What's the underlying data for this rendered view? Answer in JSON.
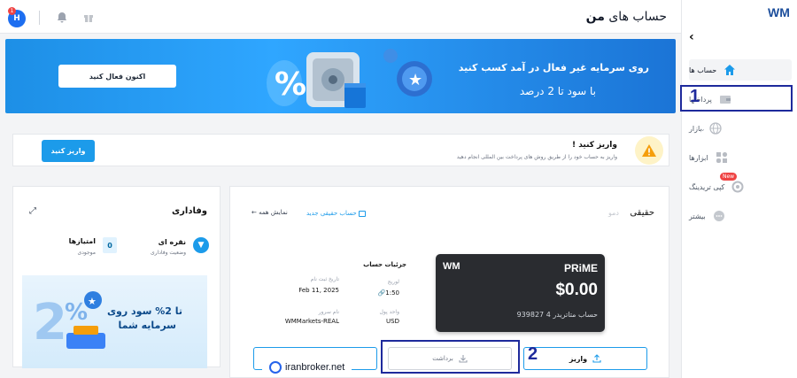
{
  "header": {
    "title_prefix": "حساب های",
    "title_bold": "من",
    "avatar_letter": "H",
    "badge_count": "1"
  },
  "sidebar": {
    "logo": "WM",
    "items": [
      {
        "label": "حساب ها"
      },
      {
        "label": "پرداختها"
      },
      {
        "label": "بازار"
      },
      {
        "label": "ابزارها"
      },
      {
        "label": "کپی تریدینگ",
        "badge": "New"
      },
      {
        "label": "بیشتر"
      }
    ]
  },
  "banner": {
    "line1": "روی سرمایه غیر فعال در آمد کسب کنید",
    "line2": "با سود تا 2 درصد",
    "button": "اکنون فعال کنید"
  },
  "deposit_prompt": {
    "title": "واریز کنید !",
    "subtitle": "واریز به حساب خود را از طریق روش های پرداخت بین المللی انجام دهید",
    "button": "واریز کنید"
  },
  "accounts": {
    "tab_real": "حقیقی",
    "tab_demo": "دمو",
    "new_account": "حساب حقیقی جدید",
    "show_all": "نمایش همه",
    "card": {
      "brand": "WM",
      "tier": "PRiME",
      "balance": "$0.00",
      "number": "939827",
      "label": "حساب",
      "type": "متاتریدر 4"
    },
    "details_title": "جزئیات حساب",
    "fields": [
      {
        "label": "تاریخ ثبت نام",
        "value": "Feb 11, 2025"
      },
      {
        "label": "لوریج",
        "value": "1:50"
      },
      {
        "label": "نام سرور",
        "value": "WMMarkets-REAL"
      },
      {
        "label": "واحد پول",
        "value": "USD"
      }
    ],
    "deposit_btn": "واریز",
    "withdraw_btn": "برداشت"
  },
  "loyalty": {
    "title": "وفاداری",
    "level": "نقره ای",
    "level_sub": "وضعیت وفاداری",
    "points_label": "امتیازها",
    "points_sub": "موجودی",
    "points_value": "0",
    "promo_line1": "تا 2% سود روی",
    "promo_line2": "سرمایه شما"
  },
  "annotations": {
    "one": "1",
    "two": "2"
  },
  "watermark": "iranbroker.net",
  "colors": {
    "accent": "#1c9bea",
    "banner": "#2fa6ff",
    "annot": "#1e2a9c",
    "card_dark": "#2a2c30"
  }
}
